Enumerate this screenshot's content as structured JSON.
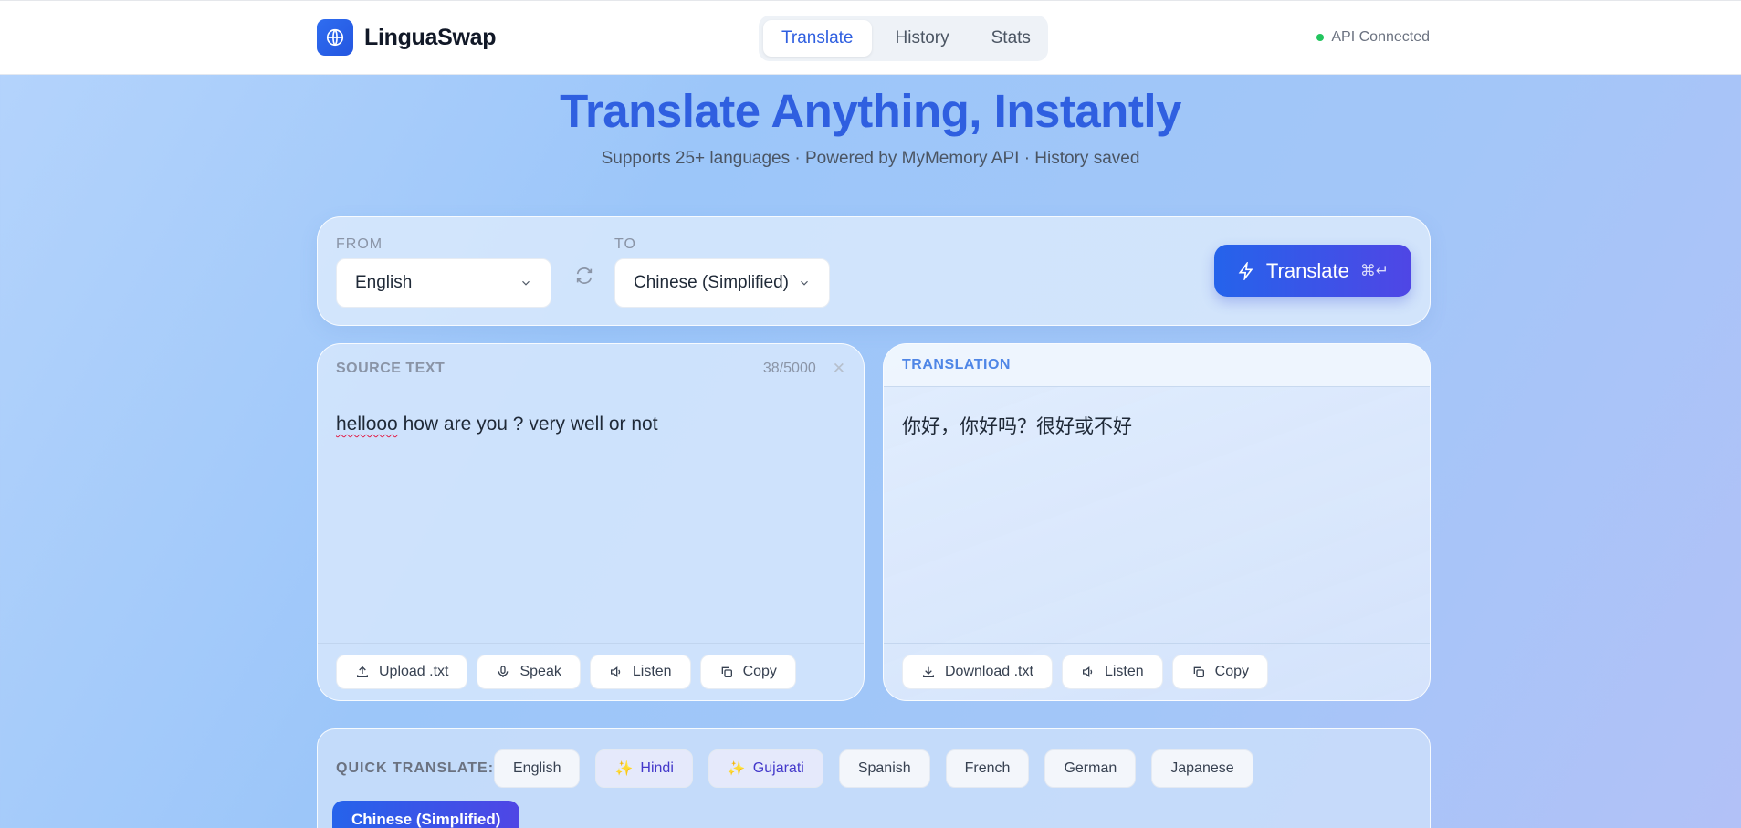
{
  "app": {
    "name": "LinguaSwap",
    "status": "API Connected"
  },
  "nav": {
    "tabs": [
      "Translate",
      "History",
      "Stats"
    ],
    "active": "Translate"
  },
  "hero": {
    "title": "Translate Anything, Instantly",
    "subtitle": "Supports 25+ languages · Powered by MyMemory API · History saved"
  },
  "languages": {
    "from_label": "FROM",
    "from_value": "English",
    "to_label": "TO",
    "to_value": "Chinese (Simplified)",
    "translate_label": "Translate",
    "shortcut": "⌘↵"
  },
  "source": {
    "title": "SOURCE TEXT",
    "counter": "38/5000",
    "misspelled": "hellooo",
    "rest": " how are you ? very well or not",
    "actions": [
      "Upload .txt",
      "Speak",
      "Listen",
      "Copy"
    ]
  },
  "translation": {
    "title": "TRANSLATION",
    "text": "你好，你好吗？很好或不好",
    "actions": [
      "Download .txt",
      "Listen",
      "Copy"
    ]
  },
  "quick": {
    "label": "QUICK TRANSLATE:",
    "chips": [
      "English",
      "Hindi",
      "Gujarati",
      "Spanish",
      "French",
      "German",
      "Japanese"
    ],
    "active": "Chinese (Simplified)"
  },
  "colors": {
    "accent": "#2f5fe0",
    "status": "#22c55e",
    "button_start": "#2563eb",
    "button_end": "#4f46e5"
  }
}
